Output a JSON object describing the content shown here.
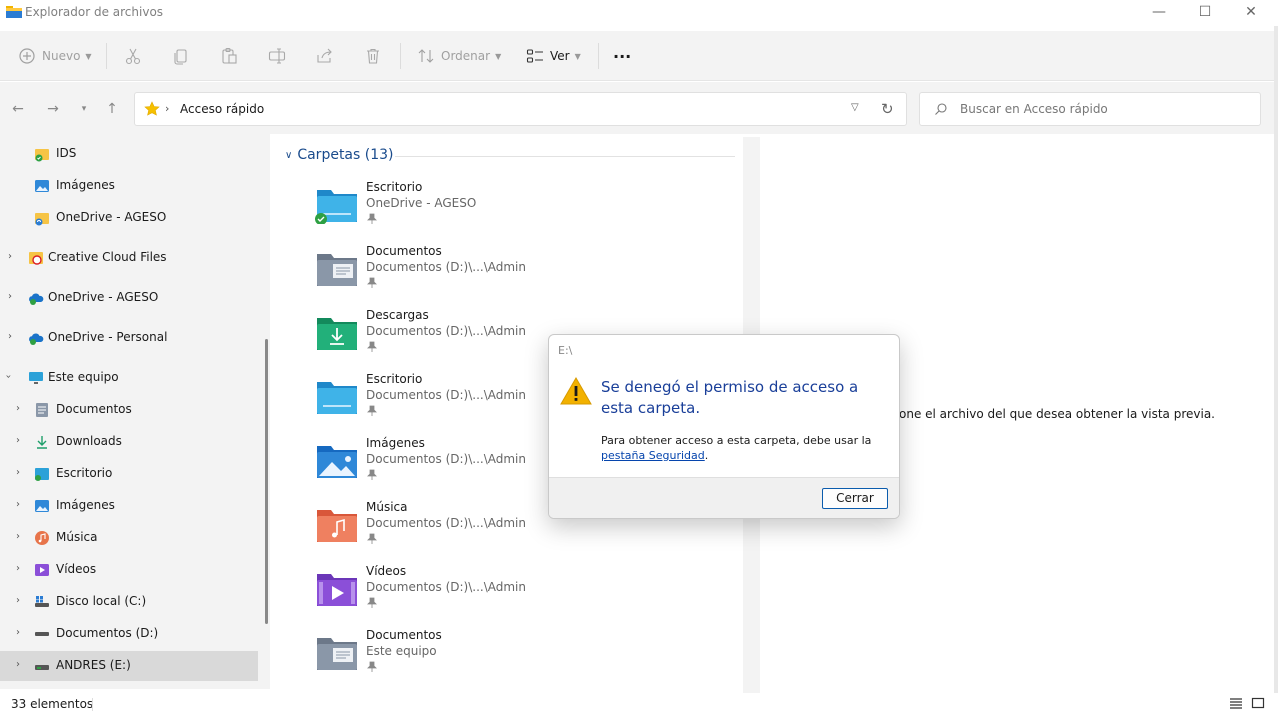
{
  "window": {
    "title": "Explorador de archivos",
    "min": "—",
    "max": "☐",
    "close": "✕"
  },
  "toolbar": {
    "new_label": "Nuevo",
    "sort_label": "Ordenar",
    "view_label": "Ver",
    "more_label": "···"
  },
  "address": {
    "path": "Acceso rápido",
    "search_placeholder": "Buscar en Acceso rápido"
  },
  "sidebar": {
    "items": [
      {
        "label": "IDS"
      },
      {
        "label": "Imágenes"
      },
      {
        "label": "OneDrive - AGESO"
      },
      {
        "label": "Creative Cloud Files"
      },
      {
        "label": "OneDrive - AGESO"
      },
      {
        "label": "OneDrive - Personal"
      },
      {
        "label": "Este equipo"
      },
      {
        "label": "Documentos"
      },
      {
        "label": "Downloads"
      },
      {
        "label": "Escritorio"
      },
      {
        "label": "Imágenes"
      },
      {
        "label": "Música"
      },
      {
        "label": "Vídeos"
      },
      {
        "label": "Disco local (C:)"
      },
      {
        "label": "Documentos (D:)"
      },
      {
        "label": "ANDRES (E:)"
      }
    ]
  },
  "main": {
    "group_title": "Carpetas (13)",
    "folders": [
      {
        "name": "Escritorio",
        "location": "OneDrive - AGESO",
        "icon": "desktop-folder-icon"
      },
      {
        "name": "Documentos",
        "location": "Documentos (D:)\\...\\Admin",
        "icon": "documents-folder-icon"
      },
      {
        "name": "Descargas",
        "location": "Documentos (D:)\\...\\Admin",
        "icon": "downloads-folder-icon"
      },
      {
        "name": "Escritorio",
        "location": "Documentos (D:)\\...\\Admin",
        "icon": "desktop-folder-icon"
      },
      {
        "name": "Imágenes",
        "location": "Documentos (D:)\\...\\Admin",
        "icon": "pictures-folder-icon"
      },
      {
        "name": "Música",
        "location": "Documentos (D:)\\...\\Admin",
        "icon": "music-folder-icon"
      },
      {
        "name": "Vídeos",
        "location": "Documentos (D:)\\...\\Admin",
        "icon": "videos-folder-icon"
      },
      {
        "name": "Documentos",
        "location": "Este equipo",
        "icon": "documents-folder-icon"
      }
    ]
  },
  "preview": {
    "message": "one el archivo del que desea obtener la vista previa."
  },
  "status": {
    "count": "33 elementos"
  },
  "dialog": {
    "title": "E:\\",
    "heading": "Se denegó el permiso de acceso a esta carpeta.",
    "body_prefix": "Para obtener acceso a esta carpeta, debe usar la ",
    "link": "pestaña Seguridad",
    "body_suffix": ".",
    "button": "Cerrar"
  },
  "colors": {
    "accent": "#0b5cad",
    "heading": "#1a3f99",
    "warning": "#f2b100"
  }
}
